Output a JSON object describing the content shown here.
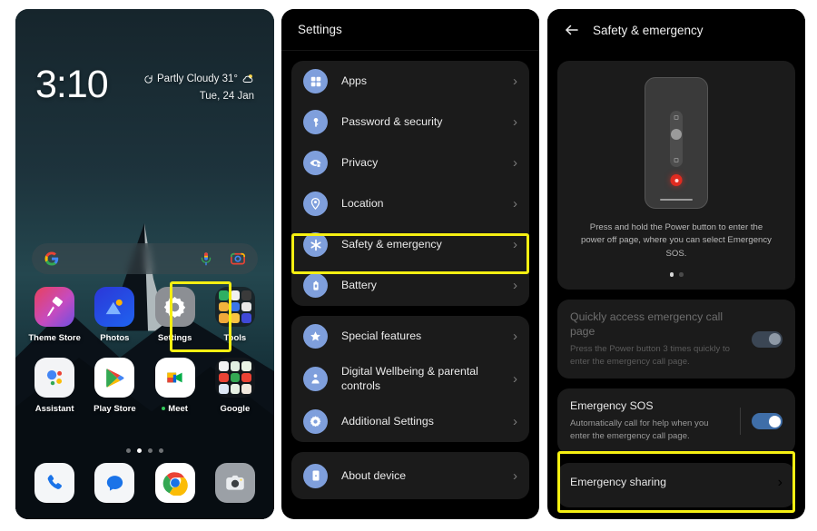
{
  "colors": {
    "highlight": "#f5ef12",
    "accent_blue": "#7f9fdc",
    "toggle_on": "#3f6ea8",
    "toggle_muted": "#3b4654",
    "sos_red": "#e02b20",
    "card_bg": "#1b1b1b",
    "panel_bg": "#000000"
  },
  "home": {
    "clock": "3:10",
    "weather": "Partly Cloudy 31°",
    "weather_icon": "partly-cloudy-icon",
    "refresh_icon": "refresh-icon",
    "date": "Tue, 24 Jan",
    "search": {
      "google_icon": "google-g-icon",
      "mic_icon": "microphone-icon",
      "lens_icon": "google-lens-icon",
      "placeholder": ""
    },
    "apps_row1": [
      {
        "label": "Theme Store",
        "icon": "theme-store-icon"
      },
      {
        "label": "Photos",
        "icon": "google-photos-icon"
      },
      {
        "label": "Settings",
        "icon": "settings-gear-icon"
      },
      {
        "label": "Tools",
        "icon": "tools-folder-icon"
      }
    ],
    "apps_row2": [
      {
        "label": "Assistant",
        "icon": "google-assistant-icon"
      },
      {
        "label": "Play Store",
        "icon": "play-store-icon"
      },
      {
        "label": "Meet",
        "icon": "google-meet-icon",
        "badge_dot": true
      },
      {
        "label": "Google",
        "icon": "google-folder-icon"
      }
    ],
    "page_dots": {
      "count": 4,
      "active_index": 1
    },
    "dock": [
      {
        "label": "Phone",
        "icon": "phone-icon"
      },
      {
        "label": "Messages",
        "icon": "messages-icon"
      },
      {
        "label": "Chrome",
        "icon": "chrome-icon"
      },
      {
        "label": "Camera",
        "icon": "camera-icon"
      }
    ],
    "highlighted_app": "Settings"
  },
  "settings": {
    "title": "Settings",
    "group1": [
      {
        "label": "Apps",
        "icon": "apps-grid-icon",
        "chevron": "›"
      },
      {
        "label": "Password & security",
        "icon": "key-icon",
        "chevron": "›"
      },
      {
        "label": "Privacy",
        "icon": "privacy-eye-icon",
        "chevron": "›"
      },
      {
        "label": "Location",
        "icon": "location-pin-icon",
        "chevron": "›"
      },
      {
        "label": "Safety & emergency",
        "icon": "asterisk-safety-icon",
        "chevron": "›",
        "highlighted": true
      },
      {
        "label": "Battery",
        "icon": "battery-icon",
        "chevron": "›"
      }
    ],
    "group2": [
      {
        "label": "Special features",
        "icon": "star-icon",
        "chevron": "›"
      },
      {
        "label": "Digital Wellbeing & parental controls",
        "icon": "wellbeing-icon",
        "chevron": "›"
      },
      {
        "label": "Additional Settings",
        "icon": "gear-icon",
        "chevron": "›"
      }
    ],
    "group3": [
      {
        "label": "About device",
        "icon": "device-info-icon",
        "chevron": "›"
      }
    ],
    "highlighted_item": "Safety & emergency"
  },
  "safety": {
    "back_icon": "back-arrow-icon",
    "title": "Safety & emergency",
    "hero": {
      "illustration": "phone-power-slider-illustration",
      "caption": "Press and hold the Power button to enter the power off page, where you can select Emergency SOS.",
      "dots": {
        "count": 2,
        "active_index": 0
      }
    },
    "quick_access": {
      "title": "Quickly access emergency call page",
      "subtitle": "Press the Power button 3 times quickly to enter the emergency call page.",
      "toggle_state": "on-dimmed",
      "dimmed": true
    },
    "emergency_sos": {
      "title": "Emergency SOS",
      "subtitle": "Automatically call for help when you enter the emergency call page.",
      "toggle_state": "on",
      "highlighted": true
    },
    "emergency_sharing": {
      "title": "Emergency sharing",
      "chevron": "›"
    }
  }
}
